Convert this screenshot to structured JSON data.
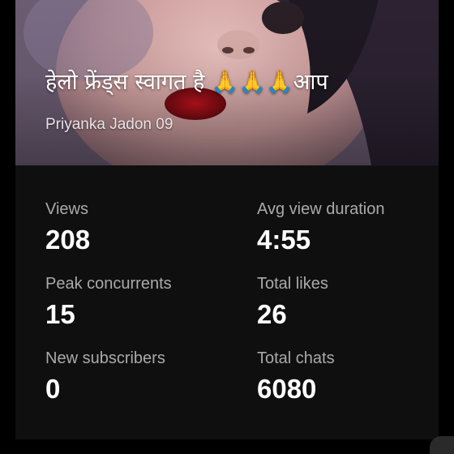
{
  "stream": {
    "title": "हेलो फ्रेंड्स स्वागत है 🙏🙏🙏आप",
    "channel": "Priyanka Jadon 09"
  },
  "stats": {
    "views": {
      "label": "Views",
      "value": "208"
    },
    "avg_view_duration": {
      "label": "Avg view duration",
      "value": "4:55"
    },
    "peak_concurrents": {
      "label": "Peak concurrents",
      "value": "15"
    },
    "total_likes": {
      "label": "Total likes",
      "value": "26"
    },
    "new_subscribers": {
      "label": "New subscribers",
      "value": "0"
    },
    "total_chats": {
      "label": "Total chats",
      "value": "6080"
    }
  },
  "colors": {
    "background": "#000000",
    "card": "#0f0f0f",
    "label": "#aaaaaa",
    "value": "#ffffff"
  }
}
